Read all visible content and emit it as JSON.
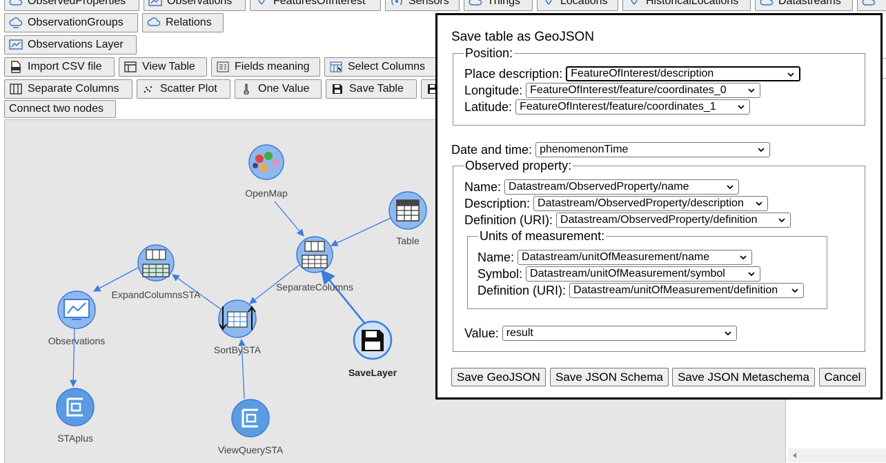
{
  "toolbar": {
    "row0": [
      "ObservedProperties",
      "Observations",
      "FeaturesOfInterest",
      "Sensors",
      "Things",
      "Locations",
      "HistoricalLocations",
      "Datastreams"
    ],
    "row1": [
      "ObservationGroups",
      "Relations"
    ],
    "row2": [
      "Observations Layer"
    ],
    "row3": [
      "Import CSV file",
      "View Table",
      "Fields meaning",
      "Select Columns"
    ],
    "row4": [
      "Separate Columns",
      "Scatter Plot",
      "One Value",
      "Save Table"
    ],
    "row5": [
      "Connect two nodes"
    ]
  },
  "graph": {
    "nodes": [
      "OpenMap",
      "Table",
      "SeparateColumns",
      "ExpandColumnsSTA",
      "Observations",
      "SortBySTA",
      "SaveLayer",
      "STAplus",
      "ViewQuerySTA"
    ]
  },
  "dialog": {
    "title": "Save table as GeoJSON",
    "position": {
      "legend": "Position:",
      "place_label": "Place description:",
      "place_value": "FeatureOfInterest/description",
      "lon_label": "Longitude:",
      "lon_value": "FeatureOfInterest/feature/coordinates_0",
      "lat_label": "Latitude:",
      "lat_value": "FeatureOfInterest/feature/coordinates_1"
    },
    "datetime_label": "Date and time:",
    "datetime_value": "phenomenonTime",
    "observed": {
      "legend": "Observed property:",
      "name_label": "Name:",
      "name_value": "Datastream/ObservedProperty/name",
      "desc_label": "Description:",
      "desc_value": "Datastream/ObservedProperty/description",
      "def_label": "Definition (URI):",
      "def_value": "Datastream/ObservedProperty/definition",
      "units": {
        "legend": "Units of measurement:",
        "name_label": "Name:",
        "name_value": "Datastream/unitOfMeasurement/name",
        "symbol_label": "Symbol:",
        "symbol_value": "Datastream/unitOfMeasurement/symbol",
        "def_label": "Definition (URI):",
        "def_value": "Datastream/unitOfMeasurement/definition"
      },
      "value_label": "Value:",
      "value_value": "result"
    },
    "buttons": {
      "save_geojson": "Save GeoJSON",
      "save_schema": "Save JSON Schema",
      "save_metaschema": "Save JSON Metaschema",
      "cancel": "Cancel"
    }
  }
}
